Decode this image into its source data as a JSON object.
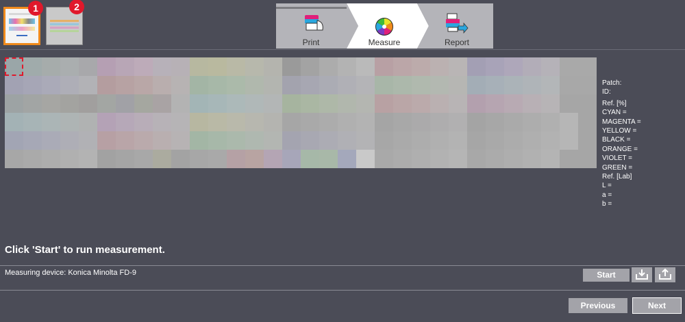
{
  "thumbnails": [
    {
      "badge": "1"
    },
    {
      "badge": "2"
    }
  ],
  "steps": [
    {
      "label": "Print",
      "icon": "printer-paper-icon"
    },
    {
      "label": "Measure",
      "icon": "color-wheel-icon"
    },
    {
      "label": "Report",
      "icon": "printer-report-icon"
    }
  ],
  "info": {
    "patch": "Patch:",
    "id": "ID:",
    "ref_pct": "Ref. [%]",
    "cyan": "CYAN =",
    "magenta": "MAGENTA =",
    "yellow": "YELLOW =",
    "black": "BLACK =",
    "orange": "ORANGE =",
    "violet": "VIOLET =",
    "green": "GREEN =",
    "ref_lab": "Ref. [Lab]",
    "l": "L =",
    "a": "a =",
    "b": "b ="
  },
  "message": "Click 'Start' to run measurement.",
  "device": "Measuring device: Konica Minolta FD-9",
  "buttons": {
    "start": "Start",
    "previous": "Previous",
    "next": "Next"
  },
  "colors": {
    "accent_orange": "#f08a1c",
    "badge_red": "#e0182b",
    "background": "#4b4c57"
  }
}
